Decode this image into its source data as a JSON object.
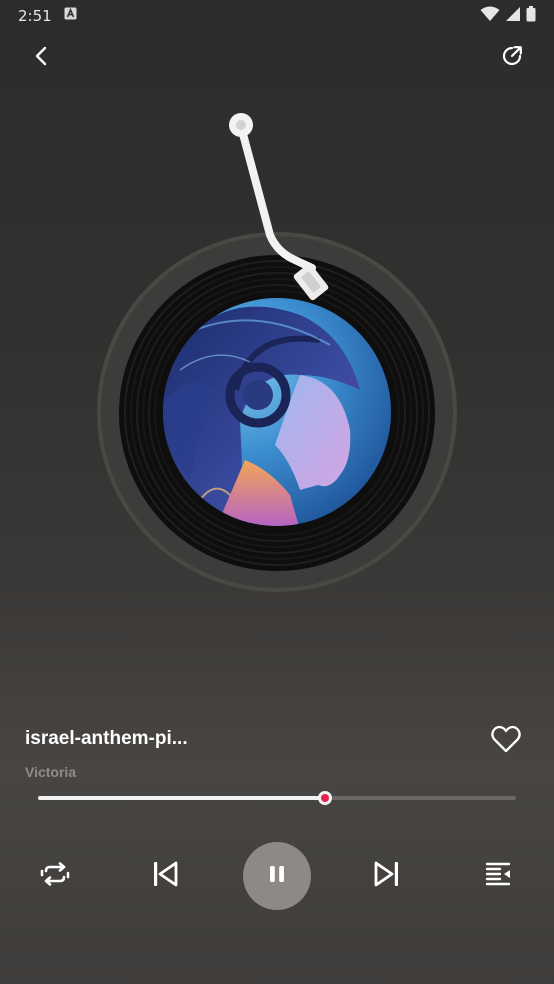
{
  "status_bar": {
    "time": "2:51"
  },
  "track": {
    "title": "israel-anthem-pi...",
    "artist": "Victoria",
    "progress": 0.6
  },
  "colors": {
    "accent": "#e8234c",
    "play_button_bg": "#8c8986"
  },
  "icons": {
    "back": "chevron-left-icon",
    "share": "share-icon",
    "favorite": "heart-icon",
    "repeat": "repeat-icon",
    "previous": "skip-previous-icon",
    "play_pause": "pause-icon",
    "next": "skip-next-icon",
    "queue": "queue-icon"
  }
}
